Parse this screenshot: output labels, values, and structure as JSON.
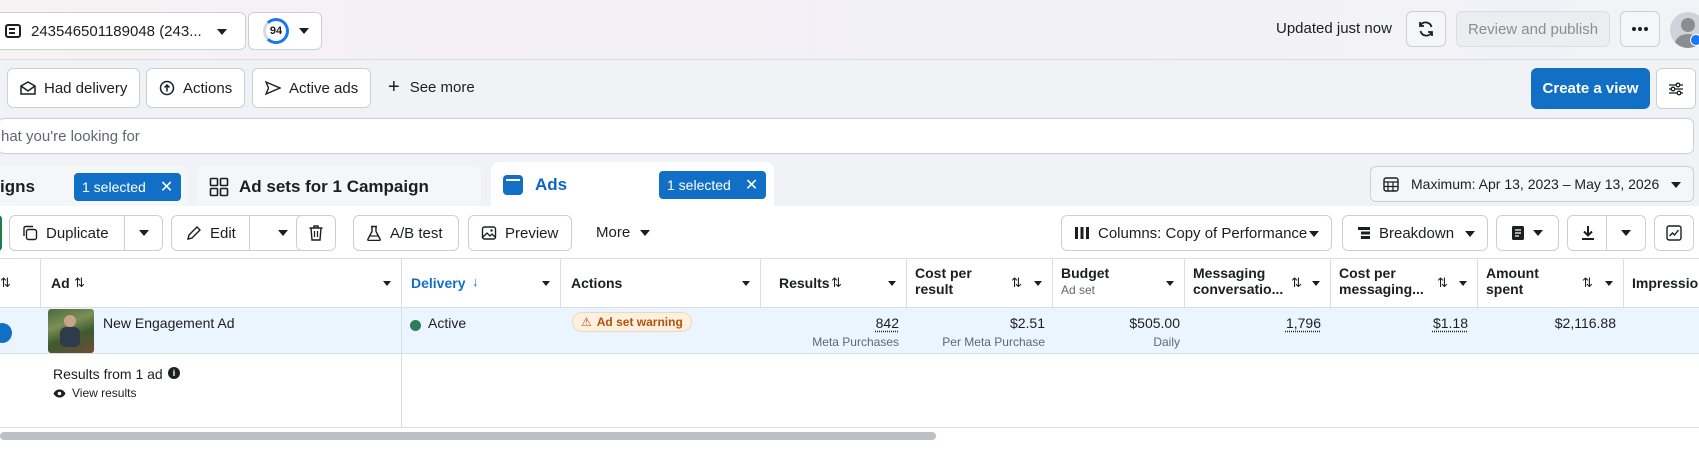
{
  "header": {
    "account_label": "243546501189048 (243...",
    "score": "94",
    "updated_text": "Updated just now",
    "review_publish_label": "Review and publish"
  },
  "filters": {
    "had_delivery_label": "Had delivery",
    "actions_label": "Actions",
    "active_ads_label": "Active ads",
    "see_more_label": "See more",
    "create_view_label": "Create a view"
  },
  "search": {
    "placeholder": "hat you're looking for"
  },
  "tabs": {
    "campaigns_label": "igns",
    "campaigns_badge": "1 selected",
    "adsets_label": "Ad sets for 1 Campaign",
    "ads_label": "Ads",
    "ads_badge": "1 selected",
    "date_range": "Maximum: Apr 13, 2023 – May 13, 2026"
  },
  "toolbar": {
    "duplicate_label": "Duplicate",
    "edit_label": "Edit",
    "ab_test_label": "A/B test",
    "preview_label": "Preview",
    "more_label": "More",
    "columns_label": "Columns: Copy of Performance",
    "breakdown_label": "Breakdown"
  },
  "table": {
    "columns": {
      "ad": "Ad",
      "delivery": "Delivery",
      "actions": "Actions",
      "results": "Results",
      "cost_per_result_1": "Cost per",
      "cost_per_result_2": "result",
      "budget": "Budget",
      "budget_sub": "Ad set",
      "messaging_1": "Messaging",
      "messaging_2": "conversatio...",
      "cost_messaging_1": "Cost per",
      "cost_messaging_2": "messaging...",
      "amount_spent_1": "Amount",
      "amount_spent_2": "spent",
      "impressions": "Impressio"
    },
    "row": {
      "ad_name": "New Engagement Ad",
      "delivery": "Active",
      "warning": "Ad set warning",
      "results": "842",
      "results_sub": "Meta Purchases",
      "cost_per_result": "$2.51",
      "cost_per_result_sub": "Per Meta Purchase",
      "budget": "$505.00",
      "budget_sub": "Daily",
      "messaging": "1,796",
      "cost_messaging": "$1.18",
      "amount_spent": "$2,116.88"
    },
    "summary": {
      "title": "Results from 1 ad",
      "view_results": "View results"
    }
  },
  "colors": {
    "primary": "#1170c6",
    "active_dot": "#2e7d5b",
    "warning": "#b45309"
  }
}
